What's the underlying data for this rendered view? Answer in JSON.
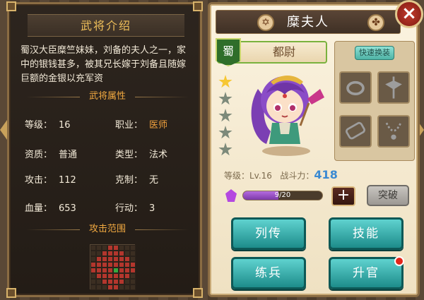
{
  "left": {
    "title": "武将介绍",
    "intro": "蜀汉大臣糜竺妹妹，刘备的夫人之一，家中的银钱甚多，被其兄长嫁于刘备且随嫁巨额的金银以充军资",
    "attr_title": "武将属性",
    "attrs": {
      "level_label": "等级：",
      "level_value": "16",
      "job_label": "职业：",
      "job_value": "医师",
      "quality_label": "资质：",
      "quality_value": "普通",
      "type_label": "类型：",
      "type_value": "法术",
      "attack_label": "攻击：",
      "attack_value": "112",
      "counter_label": "克制：",
      "counter_value": "无",
      "hp_label": "血量：",
      "hp_value": "653",
      "action_label": "行动：",
      "action_value": "3"
    },
    "range_title": "攻击范围"
  },
  "right": {
    "name": "糜夫人",
    "faction": "蜀",
    "rank": "都尉",
    "quick_equip": "快速换装",
    "level_text": "等级：Lv.16",
    "power_label": "战斗力：",
    "power_value": "418",
    "progress_text": "9/20",
    "progress_fraction": 0.45,
    "stars_total": 5,
    "stars_filled": 1,
    "plus": "+",
    "break_label": "突破",
    "buttons": {
      "biography": "列传",
      "skills": "技能",
      "train": "练兵",
      "promote": "升官"
    }
  },
  "icons": {
    "left_icon": "hexagram-icon",
    "right_icon": "swirl-icon",
    "close": "close-icon",
    "equip": [
      "ring-icon",
      "axe-icon",
      "scroll-icon",
      "necklace-icon"
    ]
  },
  "colors": {
    "accent_gold": "#f0c05a",
    "teal_button": "#1d8c8a",
    "range_red": "#b3362d",
    "range_green": "#36a840"
  }
}
